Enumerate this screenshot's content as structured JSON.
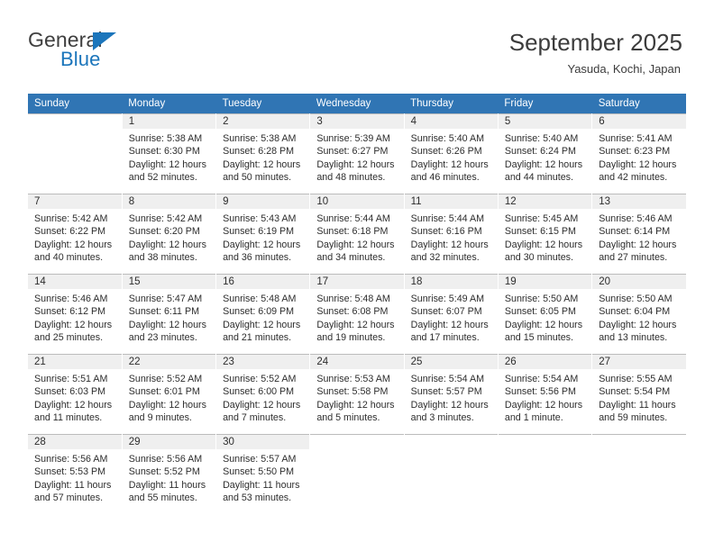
{
  "brand": {
    "word_one": "General",
    "word_two": "Blue",
    "triangle_icon": "triangle-logo-icon"
  },
  "header": {
    "title": "September 2025",
    "subtitle": "Yasuda, Kochi, Japan"
  },
  "theme": {
    "header_bg": "#3075b4",
    "daynum_bg": "#efefef",
    "brand_blue": "#1b75bb",
    "text": "#2d2d2d",
    "grid_line": "#bcbcbc"
  },
  "labels": {
    "sunrise": "Sunrise:",
    "sunset": "Sunset:",
    "daylight": "Daylight:"
  },
  "weekday_headers": [
    "Sunday",
    "Monday",
    "Tuesday",
    "Wednesday",
    "Thursday",
    "Friday",
    "Saturday"
  ],
  "weeks": [
    [
      {
        "day": ""
      },
      {
        "day": "1",
        "sunrise": "Sunrise: 5:38 AM",
        "sunset": "Sunset: 6:30 PM",
        "daylight_line1": "Daylight: 12 hours",
        "daylight_line2": "and 52 minutes."
      },
      {
        "day": "2",
        "sunrise": "Sunrise: 5:38 AM",
        "sunset": "Sunset: 6:28 PM",
        "daylight_line1": "Daylight: 12 hours",
        "daylight_line2": "and 50 minutes."
      },
      {
        "day": "3",
        "sunrise": "Sunrise: 5:39 AM",
        "sunset": "Sunset: 6:27 PM",
        "daylight_line1": "Daylight: 12 hours",
        "daylight_line2": "and 48 minutes."
      },
      {
        "day": "4",
        "sunrise": "Sunrise: 5:40 AM",
        "sunset": "Sunset: 6:26 PM",
        "daylight_line1": "Daylight: 12 hours",
        "daylight_line2": "and 46 minutes."
      },
      {
        "day": "5",
        "sunrise": "Sunrise: 5:40 AM",
        "sunset": "Sunset: 6:24 PM",
        "daylight_line1": "Daylight: 12 hours",
        "daylight_line2": "and 44 minutes."
      },
      {
        "day": "6",
        "sunrise": "Sunrise: 5:41 AM",
        "sunset": "Sunset: 6:23 PM",
        "daylight_line1": "Daylight: 12 hours",
        "daylight_line2": "and 42 minutes."
      }
    ],
    [
      {
        "day": "7",
        "sunrise": "Sunrise: 5:42 AM",
        "sunset": "Sunset: 6:22 PM",
        "daylight_line1": "Daylight: 12 hours",
        "daylight_line2": "and 40 minutes."
      },
      {
        "day": "8",
        "sunrise": "Sunrise: 5:42 AM",
        "sunset": "Sunset: 6:20 PM",
        "daylight_line1": "Daylight: 12 hours",
        "daylight_line2": "and 38 minutes."
      },
      {
        "day": "9",
        "sunrise": "Sunrise: 5:43 AM",
        "sunset": "Sunset: 6:19 PM",
        "daylight_line1": "Daylight: 12 hours",
        "daylight_line2": "and 36 minutes."
      },
      {
        "day": "10",
        "sunrise": "Sunrise: 5:44 AM",
        "sunset": "Sunset: 6:18 PM",
        "daylight_line1": "Daylight: 12 hours",
        "daylight_line2": "and 34 minutes."
      },
      {
        "day": "11",
        "sunrise": "Sunrise: 5:44 AM",
        "sunset": "Sunset: 6:16 PM",
        "daylight_line1": "Daylight: 12 hours",
        "daylight_line2": "and 32 minutes."
      },
      {
        "day": "12",
        "sunrise": "Sunrise: 5:45 AM",
        "sunset": "Sunset: 6:15 PM",
        "daylight_line1": "Daylight: 12 hours",
        "daylight_line2": "and 30 minutes."
      },
      {
        "day": "13",
        "sunrise": "Sunrise: 5:46 AM",
        "sunset": "Sunset: 6:14 PM",
        "daylight_line1": "Daylight: 12 hours",
        "daylight_line2": "and 27 minutes."
      }
    ],
    [
      {
        "day": "14",
        "sunrise": "Sunrise: 5:46 AM",
        "sunset": "Sunset: 6:12 PM",
        "daylight_line1": "Daylight: 12 hours",
        "daylight_line2": "and 25 minutes."
      },
      {
        "day": "15",
        "sunrise": "Sunrise: 5:47 AM",
        "sunset": "Sunset: 6:11 PM",
        "daylight_line1": "Daylight: 12 hours",
        "daylight_line2": "and 23 minutes."
      },
      {
        "day": "16",
        "sunrise": "Sunrise: 5:48 AM",
        "sunset": "Sunset: 6:09 PM",
        "daylight_line1": "Daylight: 12 hours",
        "daylight_line2": "and 21 minutes."
      },
      {
        "day": "17",
        "sunrise": "Sunrise: 5:48 AM",
        "sunset": "Sunset: 6:08 PM",
        "daylight_line1": "Daylight: 12 hours",
        "daylight_line2": "and 19 minutes."
      },
      {
        "day": "18",
        "sunrise": "Sunrise: 5:49 AM",
        "sunset": "Sunset: 6:07 PM",
        "daylight_line1": "Daylight: 12 hours",
        "daylight_line2": "and 17 minutes."
      },
      {
        "day": "19",
        "sunrise": "Sunrise: 5:50 AM",
        "sunset": "Sunset: 6:05 PM",
        "daylight_line1": "Daylight: 12 hours",
        "daylight_line2": "and 15 minutes."
      },
      {
        "day": "20",
        "sunrise": "Sunrise: 5:50 AM",
        "sunset": "Sunset: 6:04 PM",
        "daylight_line1": "Daylight: 12 hours",
        "daylight_line2": "and 13 minutes."
      }
    ],
    [
      {
        "day": "21",
        "sunrise": "Sunrise: 5:51 AM",
        "sunset": "Sunset: 6:03 PM",
        "daylight_line1": "Daylight: 12 hours",
        "daylight_line2": "and 11 minutes."
      },
      {
        "day": "22",
        "sunrise": "Sunrise: 5:52 AM",
        "sunset": "Sunset: 6:01 PM",
        "daylight_line1": "Daylight: 12 hours",
        "daylight_line2": "and 9 minutes."
      },
      {
        "day": "23",
        "sunrise": "Sunrise: 5:52 AM",
        "sunset": "Sunset: 6:00 PM",
        "daylight_line1": "Daylight: 12 hours",
        "daylight_line2": "and 7 minutes."
      },
      {
        "day": "24",
        "sunrise": "Sunrise: 5:53 AM",
        "sunset": "Sunset: 5:58 PM",
        "daylight_line1": "Daylight: 12 hours",
        "daylight_line2": "and 5 minutes."
      },
      {
        "day": "25",
        "sunrise": "Sunrise: 5:54 AM",
        "sunset": "Sunset: 5:57 PM",
        "daylight_line1": "Daylight: 12 hours",
        "daylight_line2": "and 3 minutes."
      },
      {
        "day": "26",
        "sunrise": "Sunrise: 5:54 AM",
        "sunset": "Sunset: 5:56 PM",
        "daylight_line1": "Daylight: 12 hours",
        "daylight_line2": "and 1 minute."
      },
      {
        "day": "27",
        "sunrise": "Sunrise: 5:55 AM",
        "sunset": "Sunset: 5:54 PM",
        "daylight_line1": "Daylight: 11 hours",
        "daylight_line2": "and 59 minutes."
      }
    ],
    [
      {
        "day": "28",
        "sunrise": "Sunrise: 5:56 AM",
        "sunset": "Sunset: 5:53 PM",
        "daylight_line1": "Daylight: 11 hours",
        "daylight_line2": "and 57 minutes."
      },
      {
        "day": "29",
        "sunrise": "Sunrise: 5:56 AM",
        "sunset": "Sunset: 5:52 PM",
        "daylight_line1": "Daylight: 11 hours",
        "daylight_line2": "and 55 minutes."
      },
      {
        "day": "30",
        "sunrise": "Sunrise: 5:57 AM",
        "sunset": "Sunset: 5:50 PM",
        "daylight_line1": "Daylight: 11 hours",
        "daylight_line2": "and 53 minutes."
      },
      {
        "day": ""
      },
      {
        "day": ""
      },
      {
        "day": ""
      },
      {
        "day": ""
      }
    ]
  ]
}
